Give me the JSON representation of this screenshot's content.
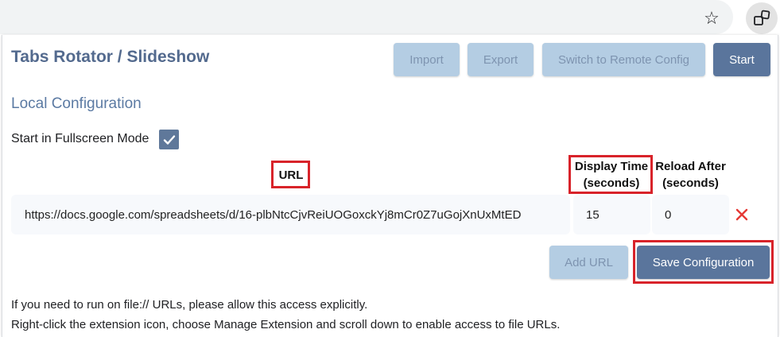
{
  "browser": {
    "star_icon": "star-icon",
    "extension_icon": "extensions-icon"
  },
  "popup": {
    "title": "Tabs Rotator / Slideshow",
    "buttons": {
      "import": "Import",
      "export": "Export",
      "switch_remote": "Switch to Remote Config",
      "start": "Start"
    },
    "section_title": "Local Configuration",
    "fullscreen": {
      "label": "Start in Fullscreen Mode",
      "checked": true
    },
    "columns": {
      "url": "URL",
      "display_time_line1": "Display Time",
      "display_time_line2": "(seconds)",
      "reload_after_line1": "Reload After",
      "reload_after_line2": "(seconds)"
    },
    "rows": [
      {
        "url": "https://docs.google.com/spreadsheets/d/16-plbNtcCjvReiUOGoxckYj8mCr0Z7uGojXnUxMtED",
        "display_time": "15",
        "reload_after": "0"
      }
    ],
    "add_url": "Add URL",
    "save_configuration": "Save Configuration",
    "info_line1": "If you need to run on file:// URLs, please allow this access explicitly.",
    "info_line2": "Right-click the extension icon, choose Manage Extension and scroll down to enable access to file URLs."
  },
  "colors": {
    "primary": "#5a759c",
    "disabled_button": "#b4cde3",
    "title": "#536a8e",
    "highlight": "#d8232a",
    "delete": "#e53935"
  }
}
